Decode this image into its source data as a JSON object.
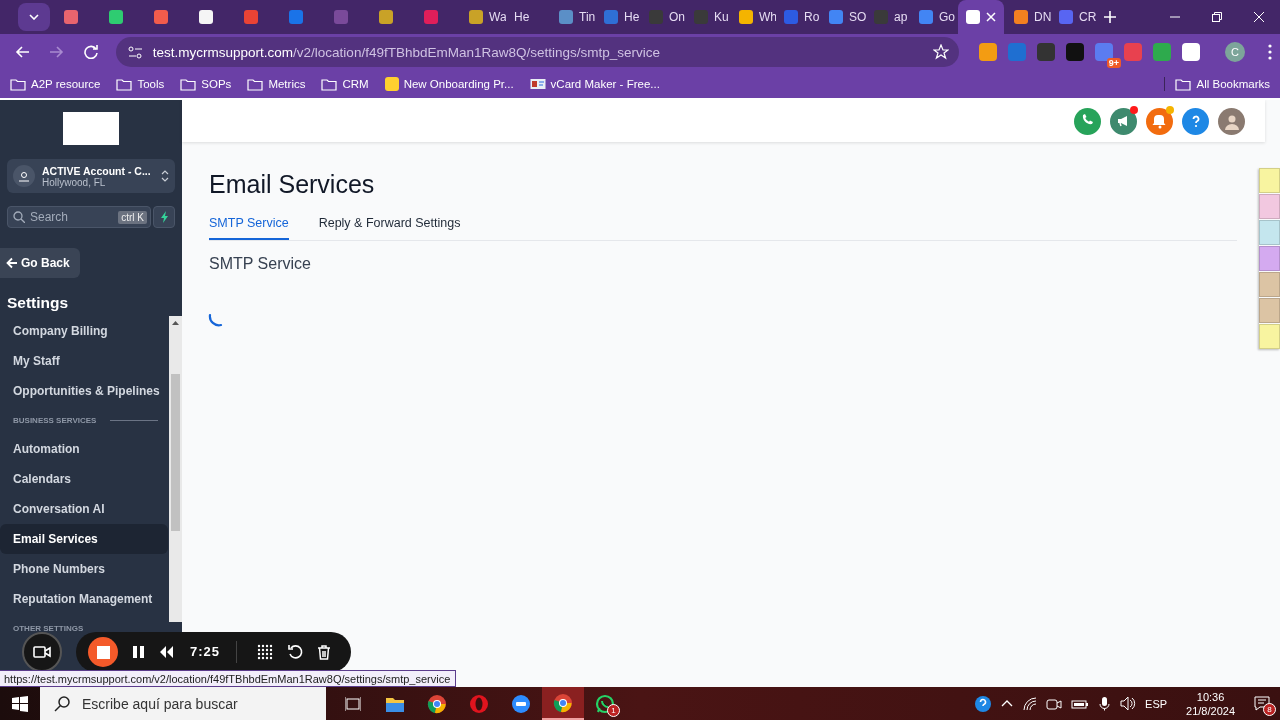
{
  "browser": {
    "tabs": [
      {
        "color": "#e8646e",
        "selected": false
      },
      {
        "color": "#2ecc71",
        "selected": false
      },
      {
        "color": "#f25c4c",
        "selected": false
      },
      {
        "color": "#f5f5f5",
        "selected": false
      },
      {
        "color": "#ea4335",
        "selected": false
      },
      {
        "color": "#1a73e8",
        "selected": false
      },
      {
        "color": "#7a4a9a",
        "selected": false
      },
      {
        "color": "#c9a227",
        "selected": false
      },
      {
        "color": "#e01e5a",
        "selected": false
      },
      {
        "title": "Wa",
        "color": "#c9a227",
        "selected": false
      },
      {
        "title": "He",
        "selected": false
      },
      {
        "title": "Tin",
        "color": "#5b8fc7",
        "selected": false
      },
      {
        "title": "He",
        "color": "#2f6fd6",
        "selected": false
      },
      {
        "title": "On",
        "color": "#3a3a3a",
        "selected": false
      },
      {
        "title": "Ku",
        "color": "#3a3a3a",
        "selected": false
      },
      {
        "title": "Wh",
        "color": "#f4b400",
        "selected": false
      },
      {
        "title": "Ro",
        "color": "#2d5be3",
        "selected": false
      },
      {
        "title": "SO",
        "color": "#4285f4",
        "selected": false
      },
      {
        "title": "ap",
        "color": "#3a3a3a",
        "selected": false
      },
      {
        "title": "Go",
        "color": "#4285f4",
        "selected": false
      },
      {
        "color": "#ffffff",
        "selected": true
      },
      {
        "title": "DN",
        "color": "#f38020",
        "selected": false
      },
      {
        "title": "CR",
        "color": "#5865f2",
        "selected": false
      }
    ],
    "address": {
      "host": "test.mycrmsupport.com",
      "path": "/v2/location/f49fTBhbdEmMan1Raw8Q/settings/smtp_service"
    },
    "extensions": [
      {
        "color": "#f39c12"
      },
      {
        "color": "#1f6fd1"
      },
      {
        "color": "#333333"
      },
      {
        "color": "#111111"
      },
      {
        "color": "#5b7cf0",
        "badge": "9+"
      },
      {
        "color": "#e8414f"
      },
      {
        "color": "#2eaa4d"
      },
      {
        "color": "#ffffff"
      }
    ],
    "profile": "C",
    "bookmarks": [
      {
        "label": "A2P resource",
        "kind": "folder"
      },
      {
        "label": "Tools",
        "kind": "folder"
      },
      {
        "label": "SOPs",
        "kind": "folder"
      },
      {
        "label": "Metrics",
        "kind": "folder"
      },
      {
        "label": "CRM",
        "kind": "folder"
      },
      {
        "label": "New Onboarding Pr...",
        "kind": "site"
      },
      {
        "label": "vCard Maker - Free...",
        "kind": "card"
      }
    ],
    "all_bookmarks": "All Bookmarks",
    "status_url": "https://test.mycrmsupport.com/v2/location/f49fTBhbdEmMan1Raw8Q/settings/smtp_service"
  },
  "sidebar": {
    "account": {
      "name": "ACTIVE Account - C...",
      "location": "Hollywood, FL"
    },
    "search": {
      "placeholder": "Search",
      "shortcut": "ctrl K"
    },
    "back": "Go Back",
    "heading": "Settings",
    "items": [
      {
        "kind": "link",
        "label": "Company Billing",
        "selected": false
      },
      {
        "kind": "link",
        "label": "My Staff",
        "selected": false
      },
      {
        "kind": "link",
        "label": "Opportunities & Pipelines",
        "selected": false
      },
      {
        "kind": "header",
        "label": "BUSINESS SERVICES"
      },
      {
        "kind": "link",
        "label": "Automation",
        "selected": false
      },
      {
        "kind": "link",
        "label": "Calendars",
        "selected": false
      },
      {
        "kind": "link",
        "label": "Conversation AI",
        "selected": false
      },
      {
        "kind": "link",
        "label": "Email Services",
        "selected": true
      },
      {
        "kind": "link",
        "label": "Phone Numbers",
        "selected": false
      },
      {
        "kind": "link",
        "label": "Reputation Management",
        "selected": false
      },
      {
        "kind": "header",
        "label": "OTHER SETTINGS"
      }
    ]
  },
  "header": {
    "actions": [
      {
        "kind": "phone",
        "color": "#27a35a"
      },
      {
        "kind": "megaphone",
        "color": "#3e8a6e",
        "badge": {
          "color": "#ff1a1a"
        }
      },
      {
        "kind": "bell",
        "color": "#f26c0f",
        "badge": {
          "color": "#f5b400"
        }
      },
      {
        "kind": "help",
        "color": "#1e88e5"
      },
      {
        "kind": "avatar",
        "color": "#8a7a70"
      }
    ]
  },
  "main": {
    "title": "Email Services",
    "tabs": [
      {
        "label": "SMTP Service",
        "selected": true
      },
      {
        "label": "Reply & Forward Settings",
        "selected": false
      }
    ],
    "section": "SMTP Service",
    "loading": true
  },
  "notes": [
    {
      "color": "#f8f4a0"
    },
    {
      "color": "#f2c8e0"
    },
    {
      "color": "#c4e6ee"
    },
    {
      "color": "#d4aaf0"
    },
    {
      "color": "#dcc4a4"
    },
    {
      "color": "#dcc4a4"
    },
    {
      "color": "#f8f4a0"
    }
  ],
  "recorder": {
    "time": "7:25"
  },
  "taskbar": {
    "search": {
      "placeholder": "Escribe aquí para buscar"
    },
    "apps": [
      {
        "kind": "taskview",
        "active": false
      },
      {
        "kind": "folder",
        "active": false
      },
      {
        "kind": "chrome",
        "active": false
      },
      {
        "kind": "opera",
        "active": false
      },
      {
        "kind": "zoom",
        "active": false
      },
      {
        "kind": "chrome",
        "active": true
      },
      {
        "kind": "whatsapp",
        "active": false,
        "badge": "1"
      }
    ],
    "language": "ESP",
    "time": "10:36",
    "date": "21/8/2024",
    "notifications": "8"
  }
}
